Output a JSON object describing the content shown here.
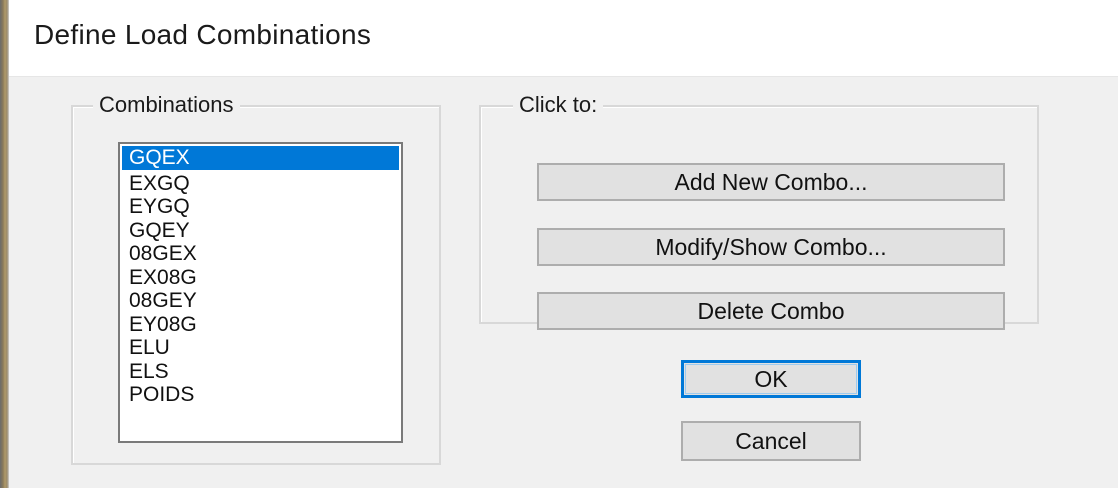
{
  "window": {
    "title": "Define Load Combinations"
  },
  "combinations": {
    "label": "Combinations",
    "items": [
      "GQEX",
      "EXGQ",
      "EYGQ",
      "GQEY",
      "08GEX",
      "EX08G",
      "08GEY",
      "EY08G",
      "ELU",
      "ELS",
      "POIDS"
    ],
    "selected": "GQEX"
  },
  "actions": {
    "label": "Click to:",
    "add": "Add New Combo...",
    "modify": "Modify/Show Combo...",
    "delete": "Delete Combo"
  },
  "dialog_buttons": {
    "ok": "OK",
    "cancel": "Cancel"
  },
  "colors": {
    "selection": "#0078d7",
    "dialog_background": "#f0f0f0",
    "button_face": "#e1e1e1"
  }
}
